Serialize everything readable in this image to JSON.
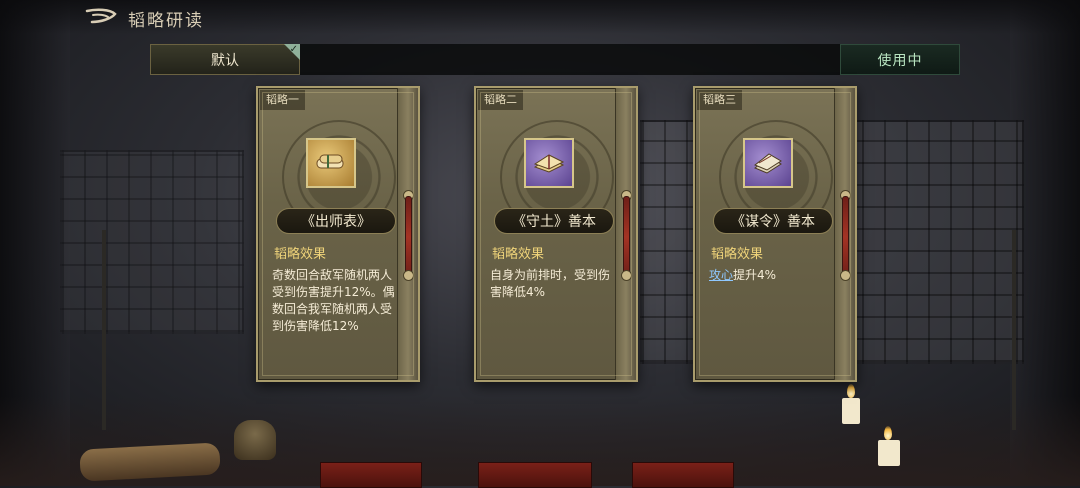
{
  "header": {
    "title": "韬略研读"
  },
  "tabs": {
    "default_label": "默认",
    "status_label": "使用中"
  },
  "cards": [
    {
      "tag": "韬略一",
      "name": "《出师表》",
      "effect_label": "韬略效果",
      "effect_text": "奇数回合敌军随机两人受到伤害提升12%。偶数回合我军随机两人受到伤害降低12%",
      "icon": "gold-scroll-icon"
    },
    {
      "tag": "韬略二",
      "name": "《守土》善本",
      "effect_label": "韬略效果",
      "effect_text": "自身为前排时，受到伤害降低4%",
      "icon": "gold-book-icon"
    },
    {
      "tag": "韬略三",
      "name": "《谋令》善本",
      "effect_label": "韬略效果",
      "effect_highlight": "攻心",
      "effect_text": "提升4%",
      "icon": "purple-book-icon"
    }
  ],
  "colors": {
    "effect_label": "#f0d47a",
    "highlight": "#8fc8ff",
    "status_text": "#b9e5c1"
  }
}
